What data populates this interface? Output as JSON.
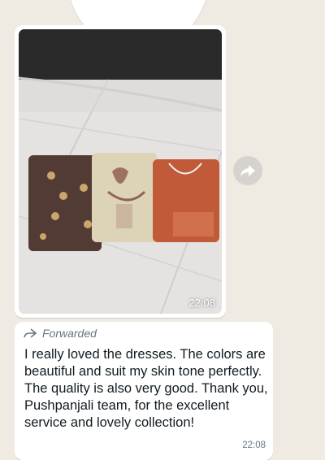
{
  "messages": {
    "image_message": {
      "time": "22:08",
      "photo_subject": "three packaged dresses on tiled floor"
    },
    "forward_button": {
      "icon": "forward-icon"
    },
    "text_message": {
      "forwarded_label": "Forwarded",
      "forwarded_icon": "forward-arrow-icon",
      "body": "I really loved the dresses. The colors are beautiful and suit my skin tone perfectly. The quality is also very good. Thank you, Pushpanjali team, for the excellent service and lovely collection!",
      "time": "22:08"
    }
  },
  "colors": {
    "chat_background": "#efeae2",
    "bubble_background": "#ffffff",
    "meta_text": "#667781",
    "body_text": "#111b21"
  }
}
